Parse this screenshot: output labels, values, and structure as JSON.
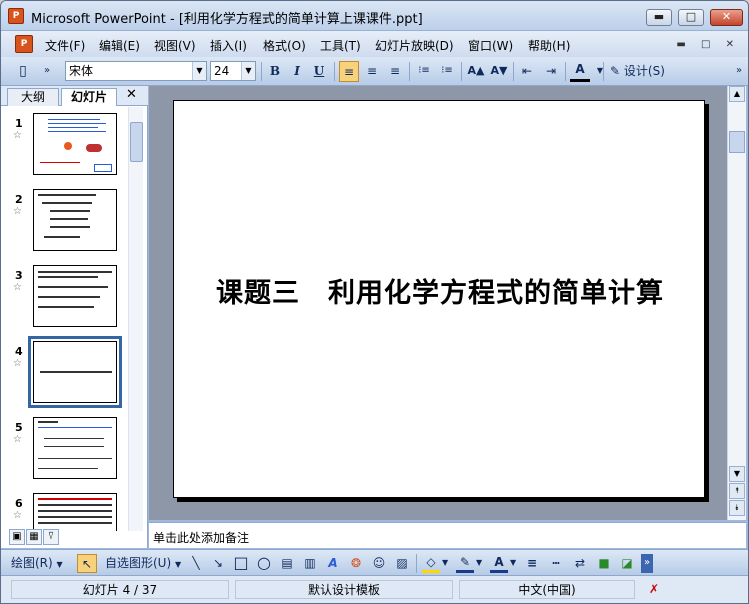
{
  "window": {
    "title": "Microsoft PowerPoint - [利用化学方程式的简单计算上课课件.ppt]",
    "app_icon": "P",
    "min_label": "▬",
    "max_label": "□",
    "close_label": "✕"
  },
  "menu": {
    "doc_icon": "P",
    "items": [
      "文件(F)",
      "编辑(E)",
      "视图(V)",
      "插入(I)",
      "格式(O)",
      "工具(T)",
      "幻灯片放映(D)",
      "窗口(W)",
      "帮助(H)"
    ],
    "window_controls": "▬ □ ✕"
  },
  "toolbar": {
    "font_name": "宋体",
    "font_size": "24",
    "bold": "B",
    "italic": "I",
    "underline": "U",
    "align_left": "≡",
    "align_center": "≡",
    "align_right": "≡",
    "numbered_list": "⁝≡",
    "bulleted_list": "⁝≡",
    "grow_font": "A▲",
    "shrink_font": "A▼",
    "decrease_indent": "⇤",
    "increase_indent": "⇥",
    "font_color": "A",
    "design_label": "设计(S)",
    "overflow": "»"
  },
  "left_pane": {
    "tab_outline": "大纲",
    "tab_slides": "幻灯片",
    "close": "✕",
    "slides": [
      {
        "num": "1",
        "star": "☆"
      },
      {
        "num": "2",
        "star": "☆"
      },
      {
        "num": "3",
        "star": "☆"
      },
      {
        "num": "4",
        "star": "☆"
      },
      {
        "num": "5",
        "star": "☆"
      },
      {
        "num": "6",
        "star": "☆"
      }
    ]
  },
  "slide": {
    "title": "课题三　利用化学方程式的简单计算"
  },
  "scroll": {
    "up": "▲",
    "down": "▼",
    "prev": "⯭",
    "next": "⯯"
  },
  "notes": {
    "placeholder": "单击此处添加备注"
  },
  "view_buttons": {
    "normal": "▣",
    "sorter": "▦",
    "show": "⍢"
  },
  "drawbar": {
    "draw": "绘图(R)",
    "select": "↖",
    "autoshapes": "自选图形(U)",
    "line": "╲",
    "arrow": "↘",
    "rect": "□",
    "oval": "○",
    "textbox": "▤",
    "vtextbox": "▥",
    "wordart": "A",
    "diagram": "❂",
    "clipart": "☺",
    "picture": "▨",
    "fill": "◇",
    "linecolor": "✎",
    "fontcolor": "A",
    "linestyle": "≡",
    "dashstyle": "┅",
    "arrowstyle": "⇄",
    "shadow": "■",
    "threed": "◪",
    "overflow": "»"
  },
  "status": {
    "slide_pos": "幻灯片 4 / 37",
    "template": "默认设计模板",
    "language": "中文(中国)",
    "spell_icon": "✗"
  },
  "colors": {
    "accent": "#3465a4",
    "toolbar": "#b7cbe7",
    "editor_bg": "#8e97a8"
  }
}
